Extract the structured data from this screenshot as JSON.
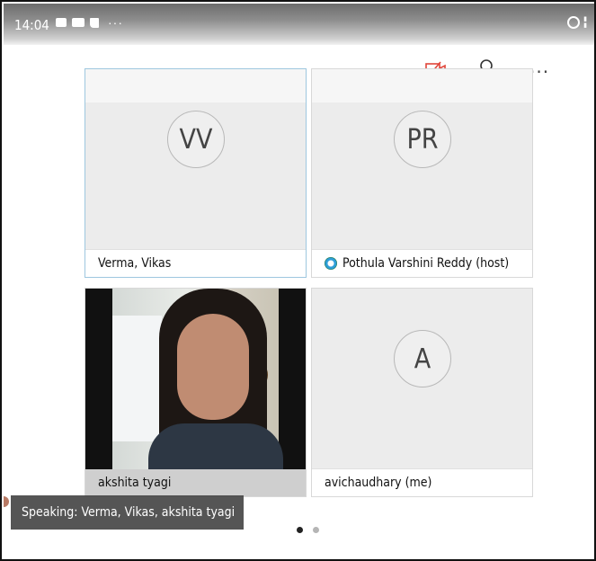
{
  "status_bar": {
    "time": "14:04",
    "notification_icons": [
      "gallery-icon",
      "video-icon",
      "chat-icon"
    ],
    "more": "···",
    "right_icons": [
      "alarm-icon",
      "network-icon"
    ]
  },
  "toolbar": {
    "video_toggle": "video-off-icon",
    "participants": "participants-icon",
    "more_label": "···"
  },
  "participants": [
    {
      "initials": "VV",
      "name": "Verma, Vikas",
      "host": false,
      "video": false,
      "active": true
    },
    {
      "initials": "PR",
      "name": "Pothula Varshini Reddy (host)",
      "host": true,
      "video": false,
      "active": false
    },
    {
      "initials": "",
      "name": "akshita tyagi",
      "host": false,
      "video": true,
      "active": false
    },
    {
      "initials": "A",
      "name": "avichaudhary (me)",
      "host": false,
      "video": false,
      "active": false
    }
  ],
  "speaking_banner": "Speaking: Verma, Vikas, akshita tyagi",
  "pagination": {
    "current": 1,
    "total": 2
  },
  "colors": {
    "accent_border": "#9ec7df",
    "video_off_red": "#e0453a",
    "toast_bg": "#464646"
  }
}
